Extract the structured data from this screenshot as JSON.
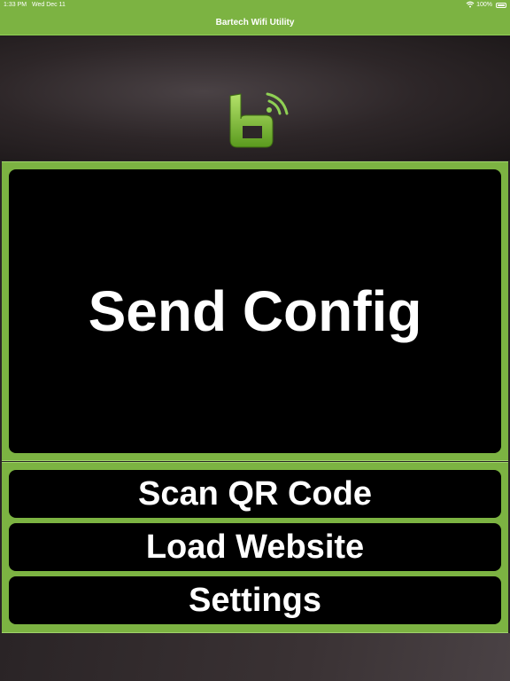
{
  "status_bar": {
    "time": "1:33 PM",
    "date": "Wed Dec 11",
    "battery_percent": "100%"
  },
  "nav": {
    "title": "Bartech Wifi Utility"
  },
  "colors": {
    "accent": "#7cb342",
    "button_bg": "#000000",
    "button_text": "#ffffff"
  },
  "actions": {
    "send_config": "Send Config",
    "scan_qr": "Scan QR Code",
    "load_website": "Load Website",
    "settings": "Settings"
  }
}
